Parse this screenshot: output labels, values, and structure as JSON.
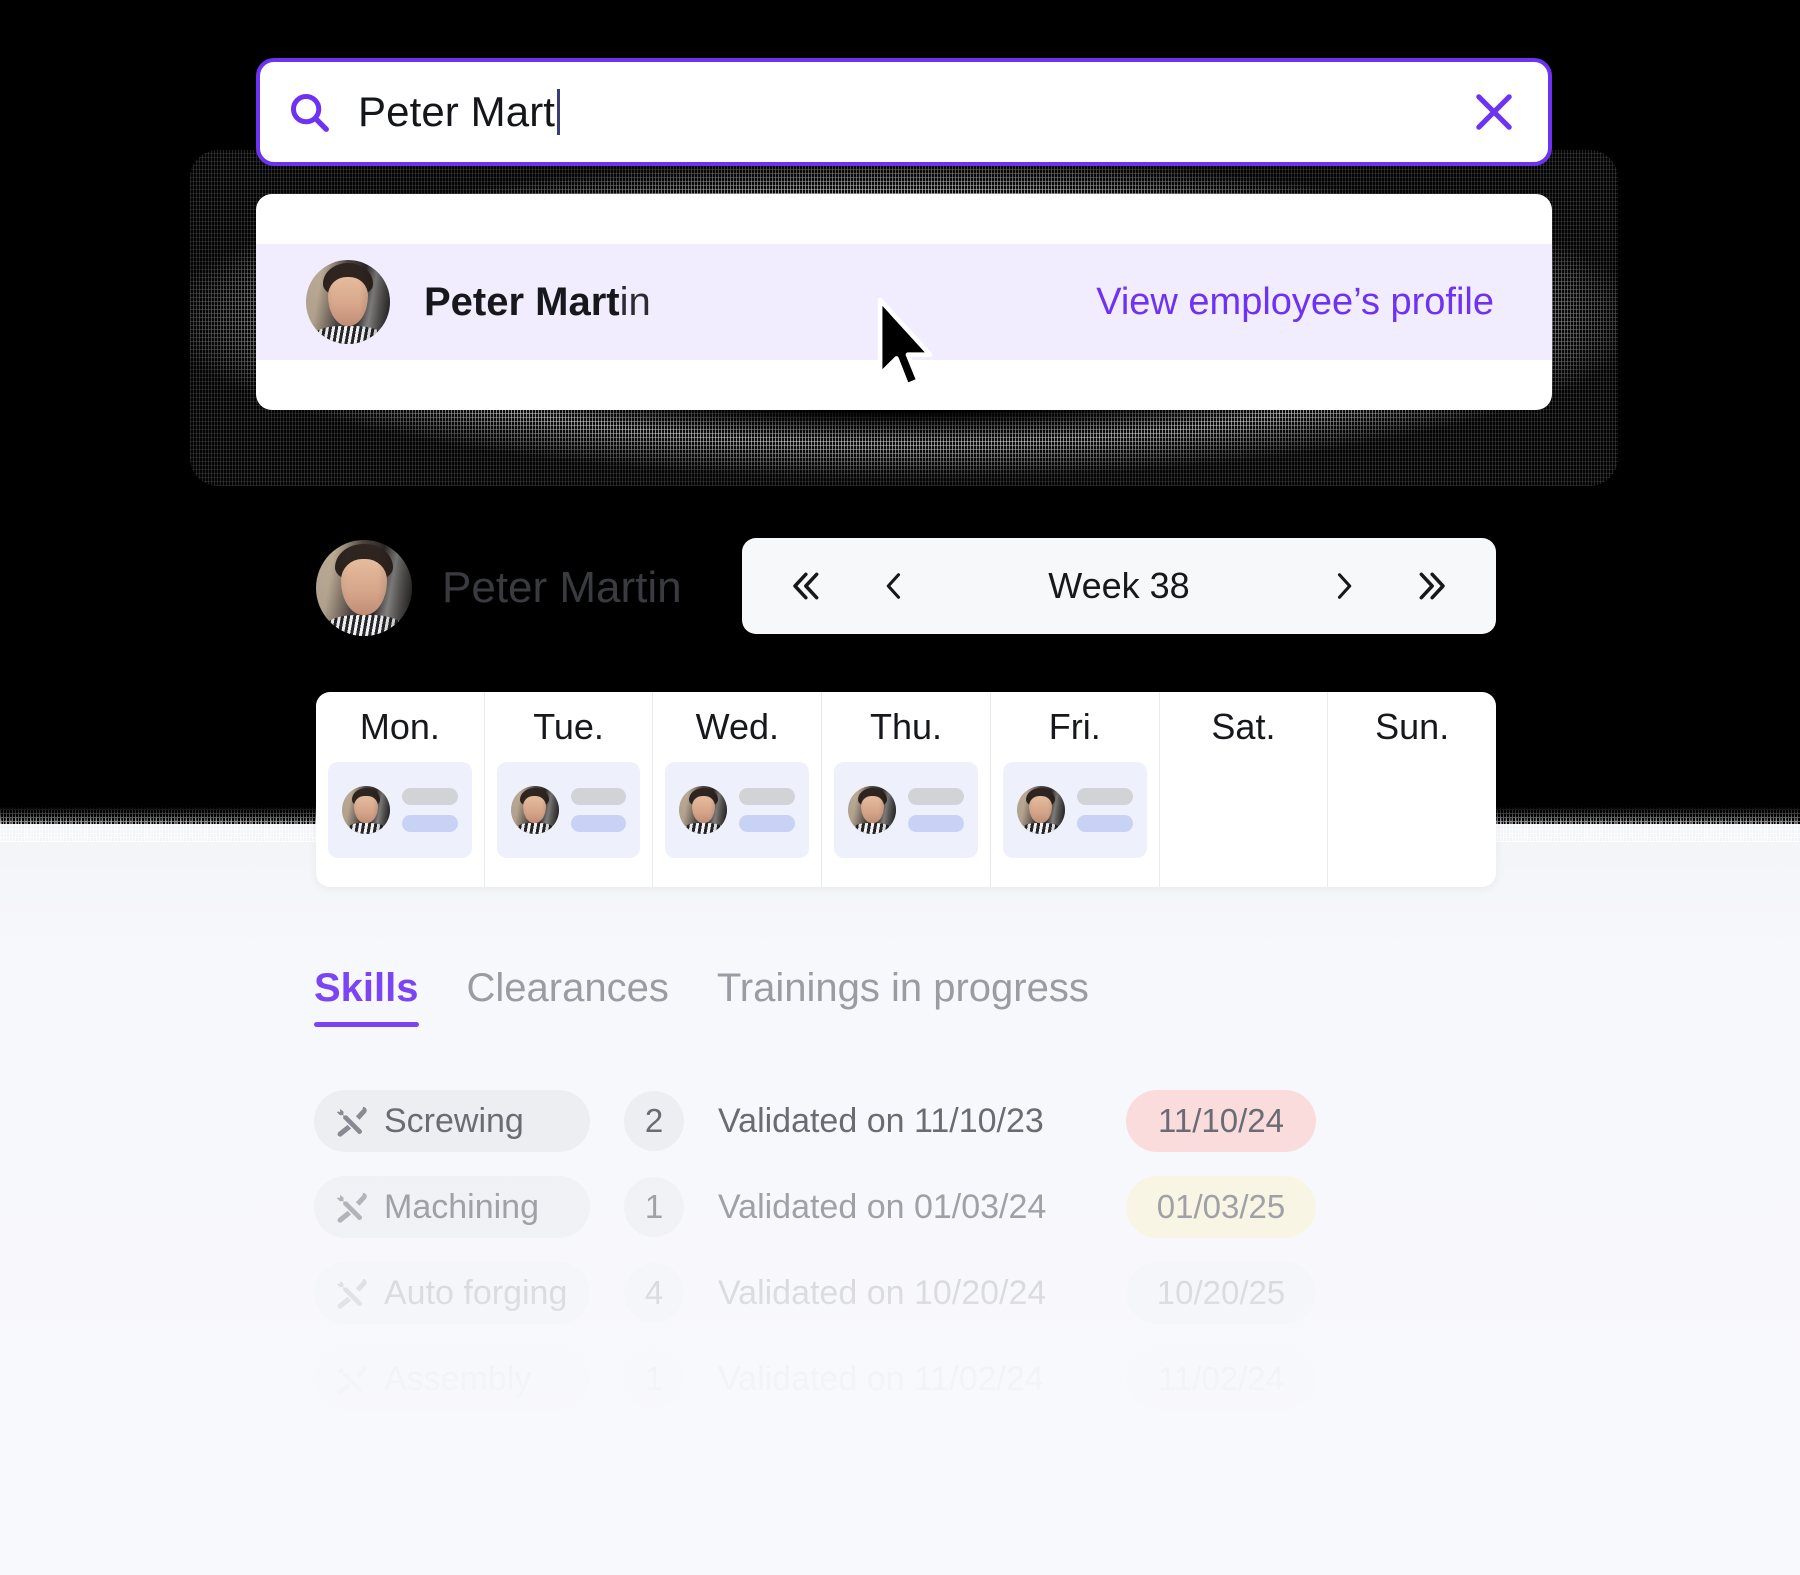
{
  "theme": {
    "accent": "#6e32f2",
    "accent_tab": "#7b45f5",
    "dropdown_row_bg": "#f1ecfe",
    "page_bg_dark": "#000000",
    "page_bg_light": "#f8f9fc",
    "badge_red": "#fadcdc",
    "badge_amber": "#faf4d8",
    "badge_plain": "#eceef2"
  },
  "search": {
    "icon": "search-icon",
    "value": "Peter Mart",
    "clear_icon": "close-x-icon"
  },
  "dropdown": {
    "result": {
      "avatar": "avatar-peter-martin",
      "name_match": "Peter Mart",
      "name_rest": "in",
      "action_label": "View employee’s profile"
    }
  },
  "profile": {
    "avatar": "avatar-peter-martin",
    "name": "Peter Martin"
  },
  "week_nav": {
    "first_icon": "chevron-double-left-icon",
    "prev_icon": "chevron-left-icon",
    "label": "Week 38",
    "next_icon": "chevron-right-icon",
    "last_icon": "chevron-double-right-icon"
  },
  "week_table": {
    "days": [
      {
        "label": "Mon.",
        "has_shift": true
      },
      {
        "label": "Tue.",
        "has_shift": true
      },
      {
        "label": "Wed.",
        "has_shift": true
      },
      {
        "label": "Thu.",
        "has_shift": true
      },
      {
        "label": "Fri.",
        "has_shift": true
      },
      {
        "label": "Sat.",
        "has_shift": false
      },
      {
        "label": "Sun.",
        "has_shift": false
      }
    ]
  },
  "tabs": [
    {
      "label": "Skills",
      "active": true
    },
    {
      "label": "Clearances",
      "active": false
    },
    {
      "label": "Trainings in progress",
      "active": false
    }
  ],
  "skills": [
    {
      "icon": "tools-icon",
      "name": "Screwing",
      "count": "2",
      "validated": "Validated on 11/10/23",
      "expiry": "11/10/24",
      "badge_style": "red"
    },
    {
      "icon": "tools-icon",
      "name": "Machining",
      "count": "1",
      "validated": "Validated on 01/03/24",
      "expiry": "01/03/25",
      "badge_style": "amber"
    },
    {
      "icon": "tools-icon",
      "name": "Auto forging",
      "count": "4",
      "validated": "Validated on 10/20/24",
      "expiry": "10/20/25",
      "badge_style": "plain"
    },
    {
      "icon": "tools-icon",
      "name": "Assembly",
      "count": "1",
      "validated": "Validated on 11/02/24",
      "expiry": "11/02/24",
      "badge_style": "plain"
    }
  ],
  "cursor": {
    "icon": "mouse-pointer-icon"
  }
}
